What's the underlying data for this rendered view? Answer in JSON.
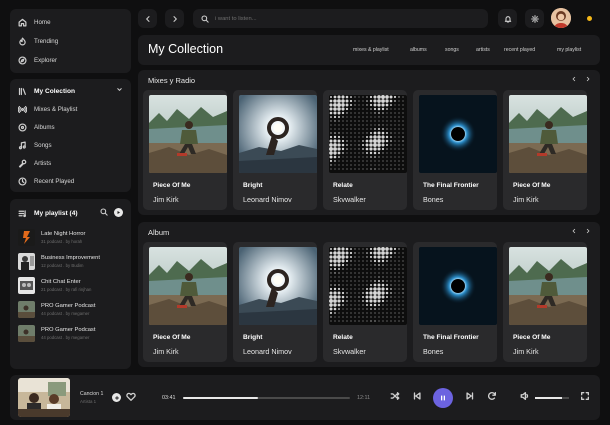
{
  "nav": {
    "top": [
      {
        "label": "Home",
        "icon": "home-icon"
      },
      {
        "label": "Trending",
        "icon": "trending-icon"
      },
      {
        "label": "Explorer",
        "icon": "compass-icon"
      }
    ],
    "library": {
      "title": "My Colection",
      "items": [
        {
          "label": "Mixes & Playlist",
          "icon": "radio-icon"
        },
        {
          "label": "Albums",
          "icon": "album-icon"
        },
        {
          "label": "Songs",
          "icon": "music-note-icon"
        },
        {
          "label": "Artists",
          "icon": "microphone-icon"
        },
        {
          "label": "Recent Played",
          "icon": "clock-icon"
        }
      ]
    },
    "playlists": {
      "title": "My playlist (4)",
      "items": [
        {
          "title": "Late Night Horror",
          "sub": "31 podcast . by horah"
        },
        {
          "title": "Business Improvement",
          "sub": "12 podcast . by Budim"
        },
        {
          "title": "Chit Chat Enter",
          "sub": "21 podcast . by rafi rinjhan"
        },
        {
          "title": "PRO Gamer Podcast",
          "sub": "44 podcast . by megamer"
        },
        {
          "title": "PRO Gamer Podcast",
          "sub": "44 podcast . by megamer"
        }
      ]
    }
  },
  "search": {
    "placeholder": "i want to listen..."
  },
  "collection": {
    "title": "My Collection",
    "tabs": [
      "mixes & playlist",
      "albums",
      "songs",
      "artists",
      "recent played",
      "my playlist"
    ]
  },
  "sections": [
    {
      "title": "Mixes y Radio",
      "cards": [
        {
          "title": "Piece Of Me",
          "artist": "Jim Kirk",
          "art": "hiker"
        },
        {
          "title": "Bright",
          "artist": "Leonard Nimov",
          "art": "sunhand"
        },
        {
          "title": "Relate",
          "artist": "Skvwalker",
          "art": "dots"
        },
        {
          "title": "The Final Frontier",
          "artist": "Bones",
          "art": "eclipse"
        },
        {
          "title": "Piece Of Me",
          "artist": "Jim Kirk",
          "art": "hiker"
        }
      ]
    },
    {
      "title": "Album",
      "cards": [
        {
          "title": "Piece Of Me",
          "artist": "Jim Kirk",
          "art": "hiker"
        },
        {
          "title": "Bright",
          "artist": "Leonard Nimov",
          "art": "sunhand"
        },
        {
          "title": "Relate",
          "artist": "Skvwalker",
          "art": "dots"
        },
        {
          "title": "The Final Frontier",
          "artist": "Bones",
          "art": "eclipse"
        },
        {
          "title": "Piece Of Me",
          "artist": "Jim Kirk",
          "art": "hiker"
        }
      ]
    }
  ],
  "player": {
    "track": "Cancion 1",
    "artist": "Artista 1",
    "time_current": "03:41",
    "time_total": "12:11",
    "progress": 0.45,
    "volume": 0.8
  },
  "colors": {
    "accent": "#6c63e0",
    "notification": "#f5b818",
    "panel": "#1c1c1e",
    "background": "#0f0f10"
  }
}
